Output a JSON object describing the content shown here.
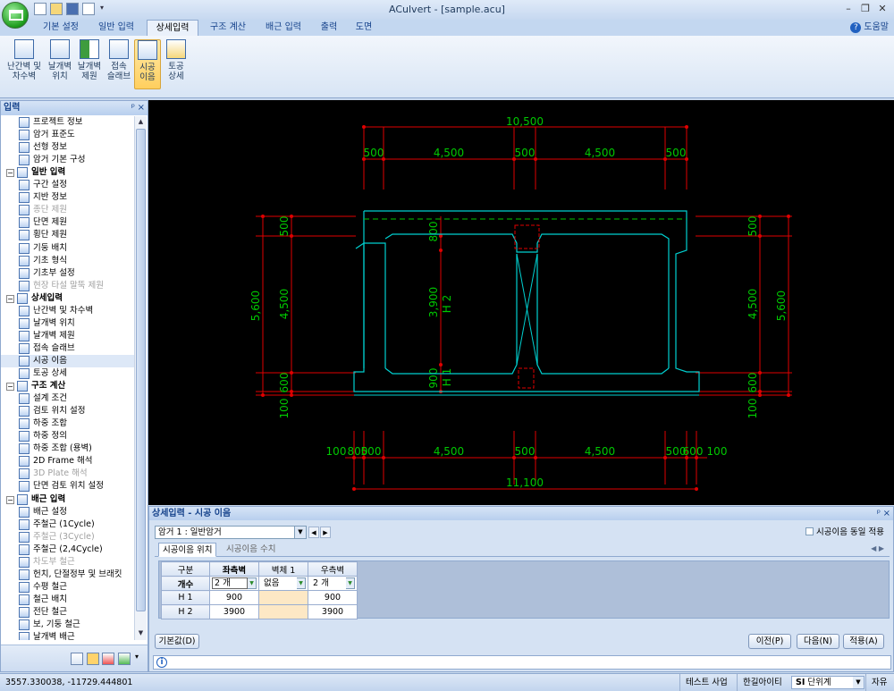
{
  "window": {
    "title": "ACulvert - [sample.acu]"
  },
  "ribbon": {
    "tabs": [
      "기본 설정",
      "일반 입력",
      "상세입력",
      "구조 계산",
      "배근 입력",
      "출력",
      "도면"
    ],
    "help_label": "도움말",
    "buttons": [
      {
        "line1": "난간벽 및",
        "line2": "차수벽"
      },
      {
        "line1": "날개벽",
        "line2": "위치"
      },
      {
        "line1": "날개벽",
        "line2": "제원"
      },
      {
        "line1": "접속",
        "line2": "슬래브"
      },
      {
        "line1": "시공",
        "line2": "이음"
      },
      {
        "line1": "토공",
        "line2": "상세"
      }
    ]
  },
  "left_panel": {
    "title": "입력",
    "pin": "ᵖ",
    "close": "×",
    "items": [
      {
        "label": "프로젝트 정보",
        "type": "item"
      },
      {
        "label": "암거 표준도",
        "type": "item"
      },
      {
        "label": "선형 정보",
        "type": "item"
      },
      {
        "label": "암거 기본 구성",
        "type": "item"
      },
      {
        "label": "일반 입력",
        "type": "group"
      },
      {
        "label": "구간 설정",
        "type": "item"
      },
      {
        "label": "지반 정보",
        "type": "item"
      },
      {
        "label": "종단 제원",
        "type": "disabled"
      },
      {
        "label": "단면 제원",
        "type": "item"
      },
      {
        "label": "횡단 제원",
        "type": "item"
      },
      {
        "label": "기둥 배치",
        "type": "item"
      },
      {
        "label": "기초 형식",
        "type": "item"
      },
      {
        "label": "기초부 설정",
        "type": "item"
      },
      {
        "label": "현장 타설 말뚝 제원",
        "type": "disabled"
      },
      {
        "label": "상세입력",
        "type": "group"
      },
      {
        "label": "난간벽 및 차수벽",
        "type": "item"
      },
      {
        "label": "날개벽 위치",
        "type": "item"
      },
      {
        "label": "날개벽 제원",
        "type": "item"
      },
      {
        "label": "접속 슬래브",
        "type": "item"
      },
      {
        "label": "시공 이음",
        "type": "selected"
      },
      {
        "label": "토공 상세",
        "type": "item"
      },
      {
        "label": "구조 계산",
        "type": "group"
      },
      {
        "label": "설계 조건",
        "type": "item"
      },
      {
        "label": "검토 위치 설정",
        "type": "item"
      },
      {
        "label": "하중 조합",
        "type": "item"
      },
      {
        "label": "하중 정의",
        "type": "item"
      },
      {
        "label": "하중 조합 (용벽)",
        "type": "item"
      },
      {
        "label": "2D Frame 해석",
        "type": "item"
      },
      {
        "label": "3D Plate 해석",
        "type": "disabled"
      },
      {
        "label": "단면 검토 위치 설정",
        "type": "item"
      },
      {
        "label": "배근 입력",
        "type": "group"
      },
      {
        "label": "배근 설정",
        "type": "item"
      },
      {
        "label": "주철근 (1Cycle)",
        "type": "item"
      },
      {
        "label": "주철근 (3Cycle)",
        "type": "disabled"
      },
      {
        "label": "주철근 (2,4Cycle)",
        "type": "item"
      },
      {
        "label": "차도부 철근",
        "type": "disabled"
      },
      {
        "label": "헌치, 단절정부 및 브래킷",
        "type": "item"
      },
      {
        "label": "수평 철근",
        "type": "item"
      },
      {
        "label": "철근 배치",
        "type": "item"
      },
      {
        "label": "전단 철근",
        "type": "item"
      },
      {
        "label": "보, 기둥 철근",
        "type": "item"
      },
      {
        "label": "날개벽 배근",
        "type": "item"
      }
    ]
  },
  "drawing": {
    "dims": {
      "top_total": "10,500",
      "top_segments": [
        "500",
        "4,500",
        "500",
        "4,500",
        "500"
      ],
      "left_outer": "5,600",
      "left_inner": [
        "500",
        "4,500",
        "600",
        "100"
      ],
      "center": [
        "800",
        "3,900",
        "900"
      ],
      "center_labels": [
        "H 2",
        "H 1"
      ],
      "right_inner": [
        "500",
        "4,500",
        "600",
        "100"
      ],
      "right_outer": "5,600",
      "bottom_segments": [
        "100",
        "800",
        "500",
        "4,500",
        "500",
        "4,500",
        "500",
        "600",
        "100"
      ],
      "bottom_total": "11,100"
    },
    "colors": {
      "dim_line": "#e00000",
      "dim_text": "#00c800",
      "structure": "#00d0d0",
      "member": "#e00000"
    }
  },
  "bottom_panel": {
    "title": "상세입력 - 시공 이음",
    "combo_value": "암거 1 : 일반암거",
    "same_apply_label": "시공이음 동일 적용",
    "tabs": [
      "시공이음 위치",
      "시공이음 수치"
    ],
    "grid": {
      "headers": [
        "구분",
        "좌측벽",
        "벽체 1",
        "우측벽"
      ],
      "count_label": "개수",
      "counts": [
        "2 개",
        "없음",
        "2 개"
      ],
      "rows": [
        {
          "label": "H 1",
          "values": [
            "900",
            "",
            "900"
          ]
        },
        {
          "label": "H 2",
          "values": [
            "3900",
            "",
            "3900"
          ]
        }
      ]
    },
    "buttons": {
      "default": "기본값(D)",
      "prev": "이전(P)",
      "next": "다음(N)",
      "apply": "적용(A)"
    }
  },
  "status": {
    "coords": "3557.330038,  -11729.444801",
    "project": "테스트 사업",
    "company": "한길아이티",
    "unit_prefix": "SI",
    "unit_label": "단위계",
    "mode": "자유"
  }
}
